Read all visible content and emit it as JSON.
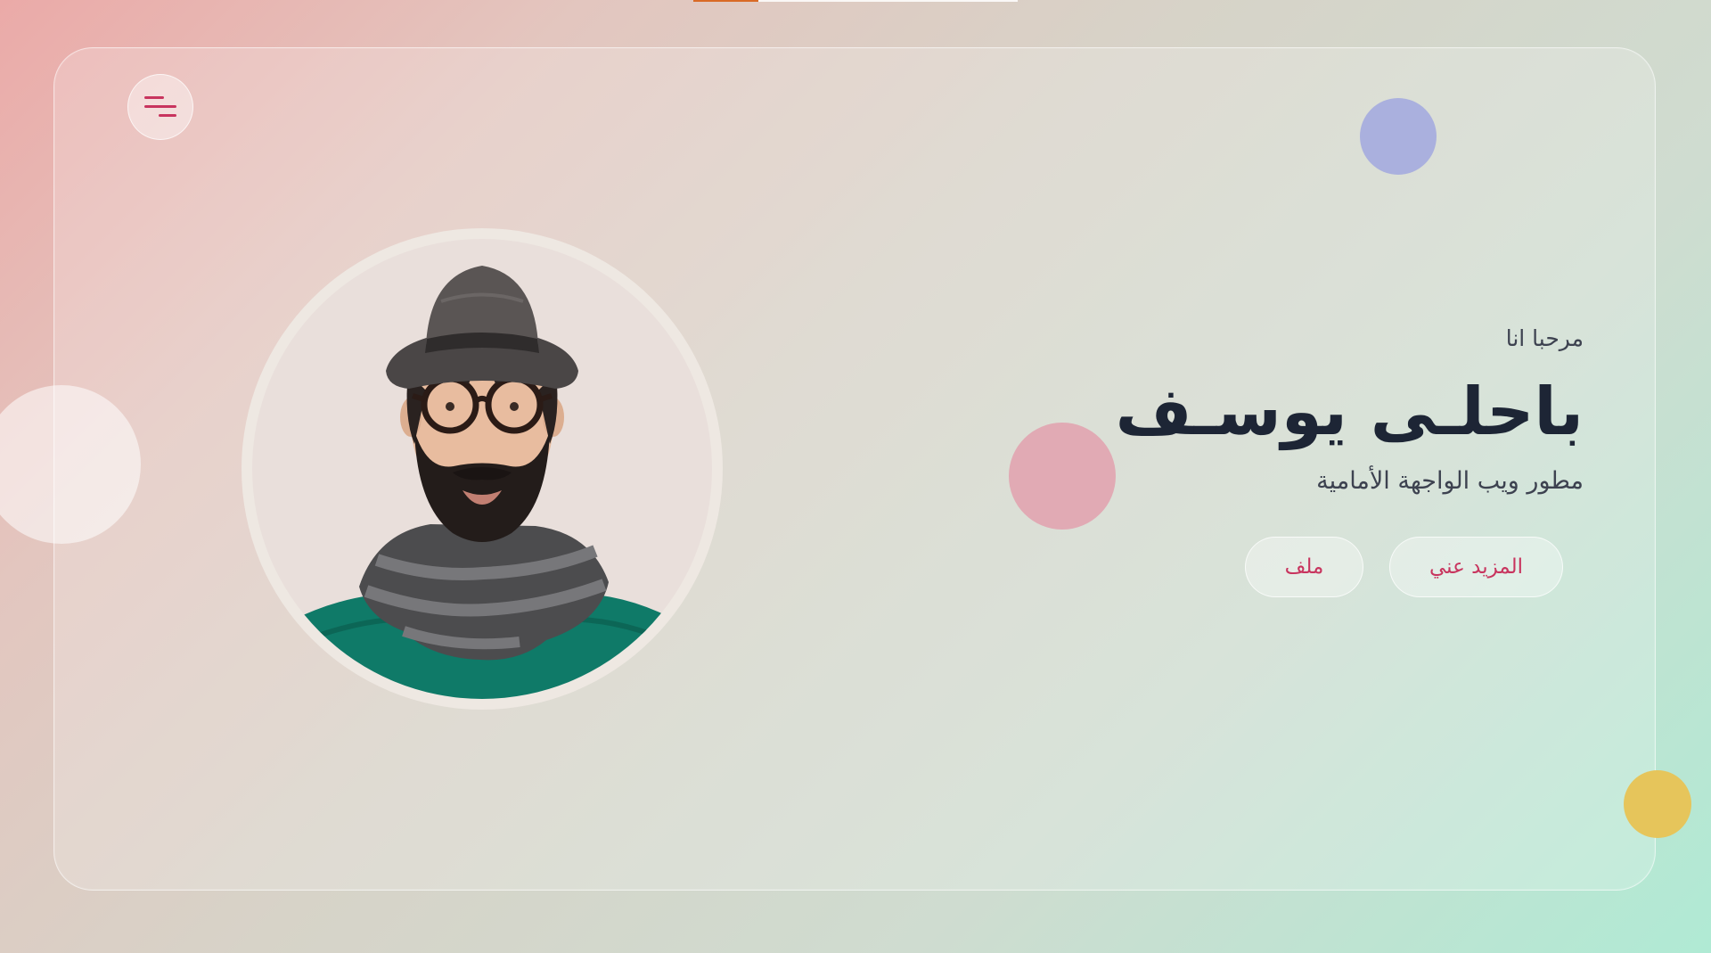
{
  "progress": {
    "fraction": 0.2
  },
  "hero": {
    "greeting": "مرحبا انا",
    "name": "باحلـى يوسـف",
    "role": "مطور ويب الواجهة الأمامية",
    "buttons": {
      "more_about": "المزيد عني",
      "file": "ملف"
    }
  },
  "icons": {
    "menu": "menu-icon"
  },
  "colors": {
    "accent": "#c8345e",
    "heading": "#1d2535",
    "progress": "#d96a26",
    "blob_purple": "#aab0de",
    "blob_pink": "#e1aab4",
    "blob_yellow": "#e6c55b"
  }
}
